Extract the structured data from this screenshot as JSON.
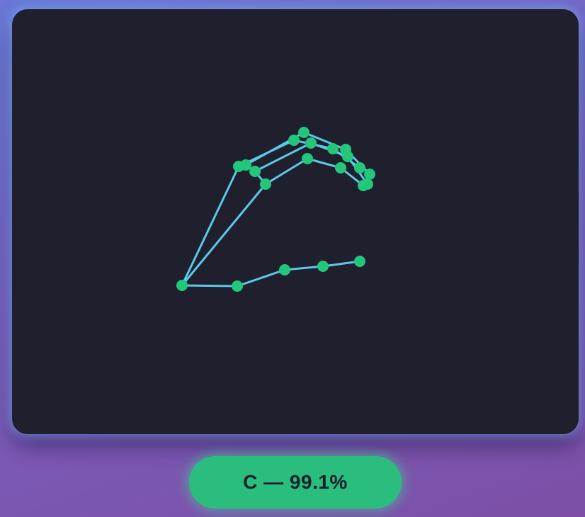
{
  "prediction": {
    "label": "C — 99.1%"
  },
  "hand": {
    "colors": {
      "bone": "#5bc8e8",
      "joint": "#22c77a",
      "canvas": "#1f1f2e",
      "pill": "#2bbd7e"
    }
  }
}
